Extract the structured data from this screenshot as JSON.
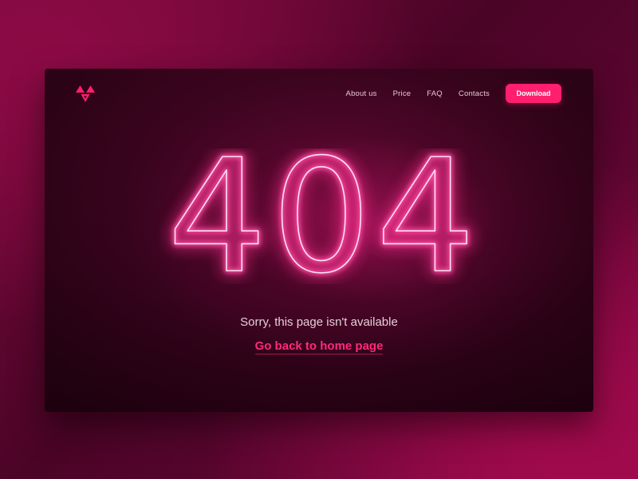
{
  "logo": {
    "icon": "triangles-logo-icon",
    "color": "#ff1f6e"
  },
  "nav": {
    "links": [
      {
        "label": "About us"
      },
      {
        "label": "Price"
      },
      {
        "label": "FAQ"
      },
      {
        "label": "Contacts"
      }
    ],
    "download_label": "Download"
  },
  "error": {
    "code": "404",
    "message": "Sorry, this page isn't available",
    "home_link": "Go back to home page"
  },
  "colors": {
    "accent": "#ff1f6e",
    "neon": "#ff5fb0",
    "background": "#4a0426"
  }
}
